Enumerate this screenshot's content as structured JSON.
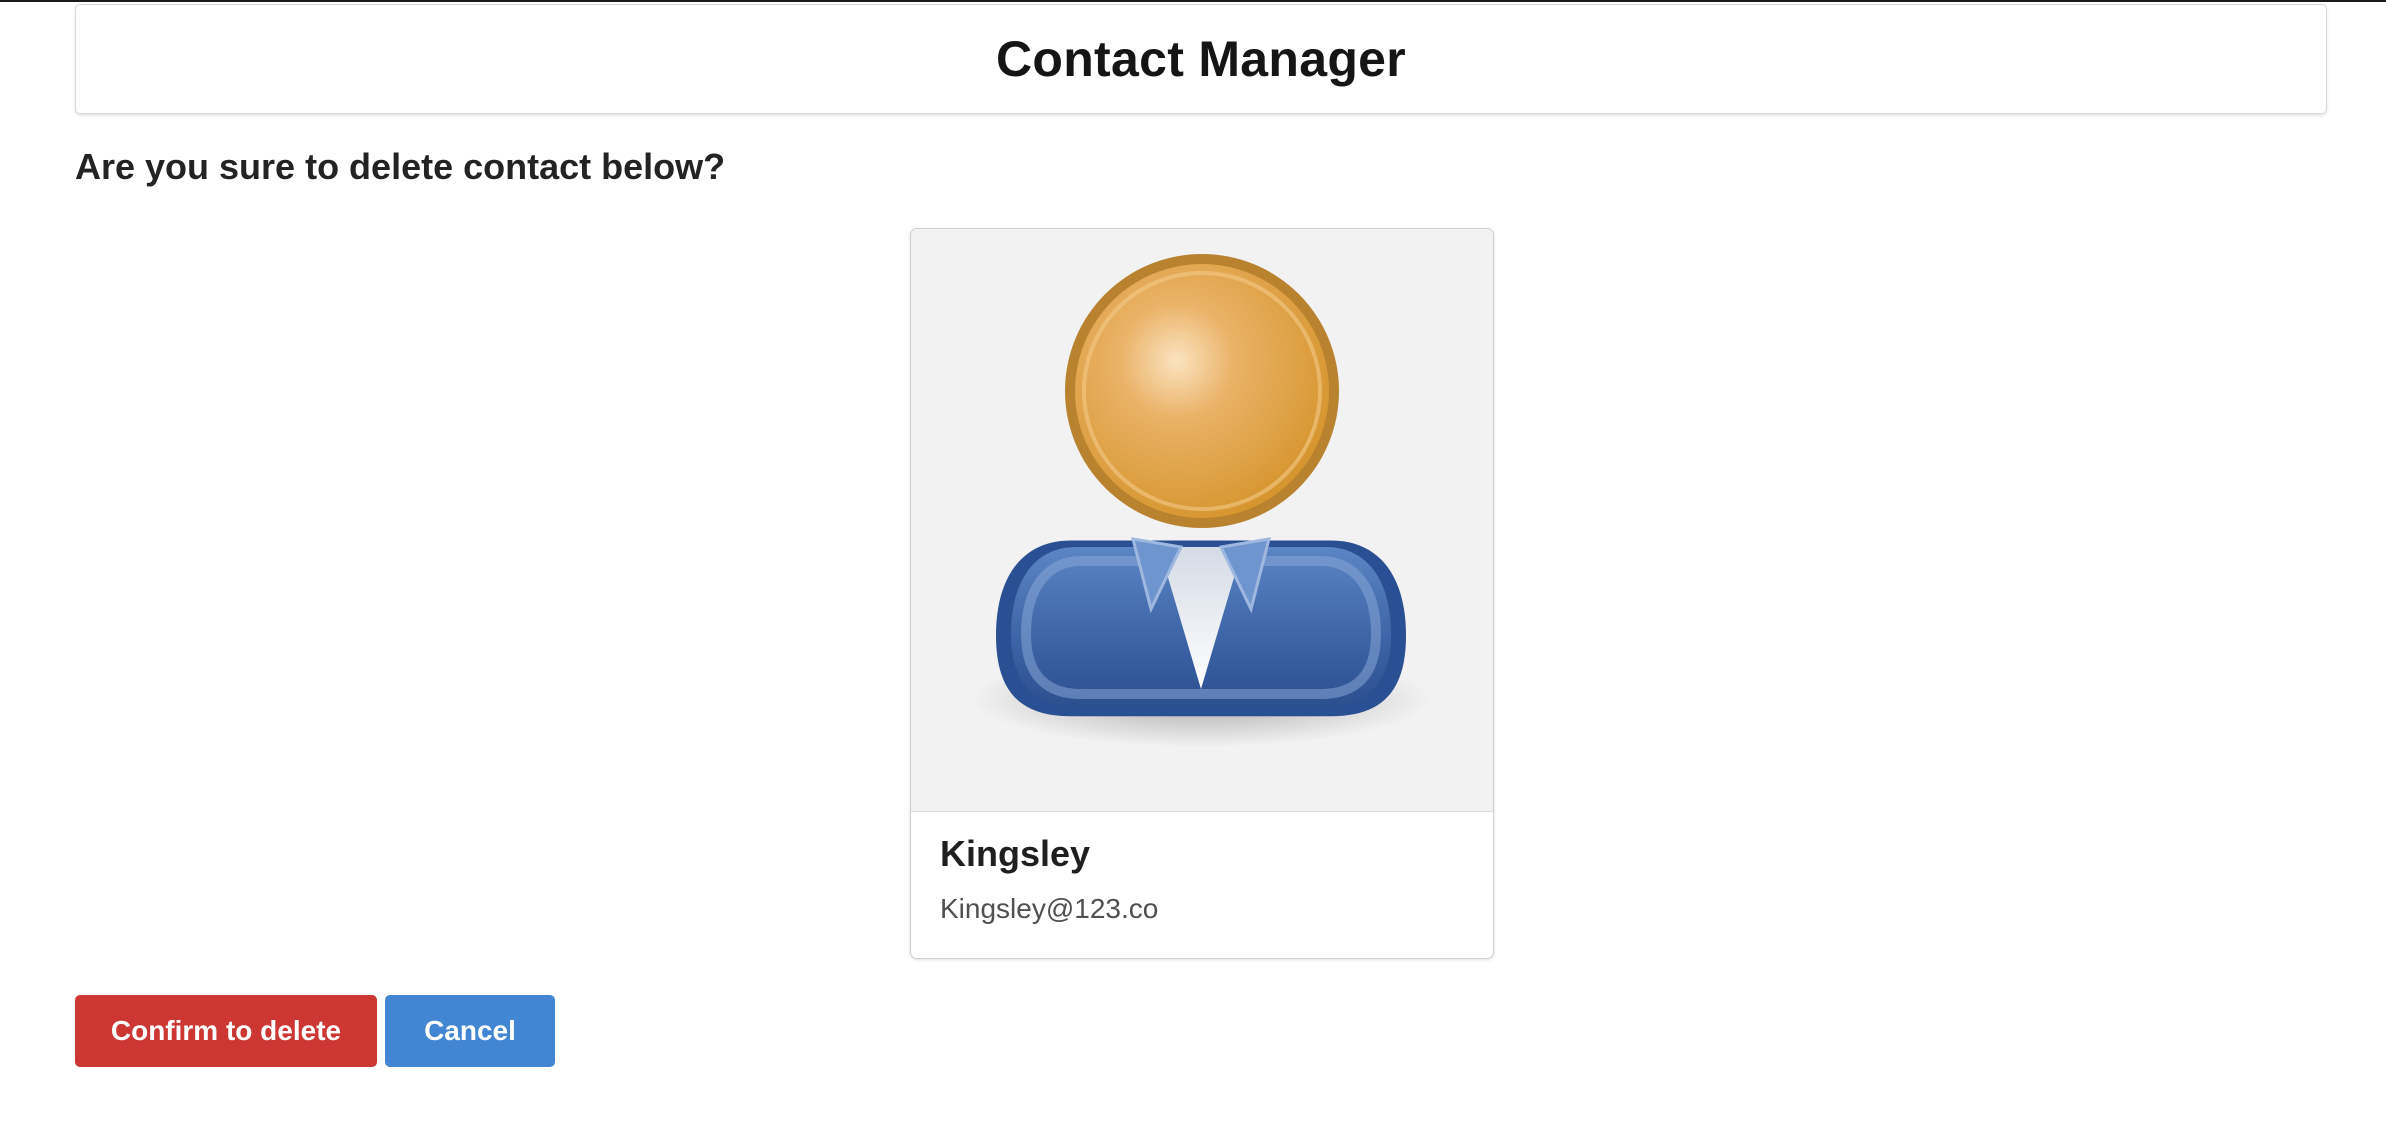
{
  "header": {
    "title": "Contact Manager"
  },
  "prompt": {
    "text": "Are you sure to delete contact below?"
  },
  "contact": {
    "name": "Kingsley",
    "email": "Kingsley@123.co",
    "avatar_icon": "user-avatar-icon"
  },
  "actions": {
    "confirm_label": "Confirm to delete",
    "cancel_label": "Cancel"
  },
  "colors": {
    "danger": "#cc3633",
    "primary": "#4185d3",
    "avatar_head": "#d99a3a",
    "avatar_body": "#3e66a8"
  }
}
